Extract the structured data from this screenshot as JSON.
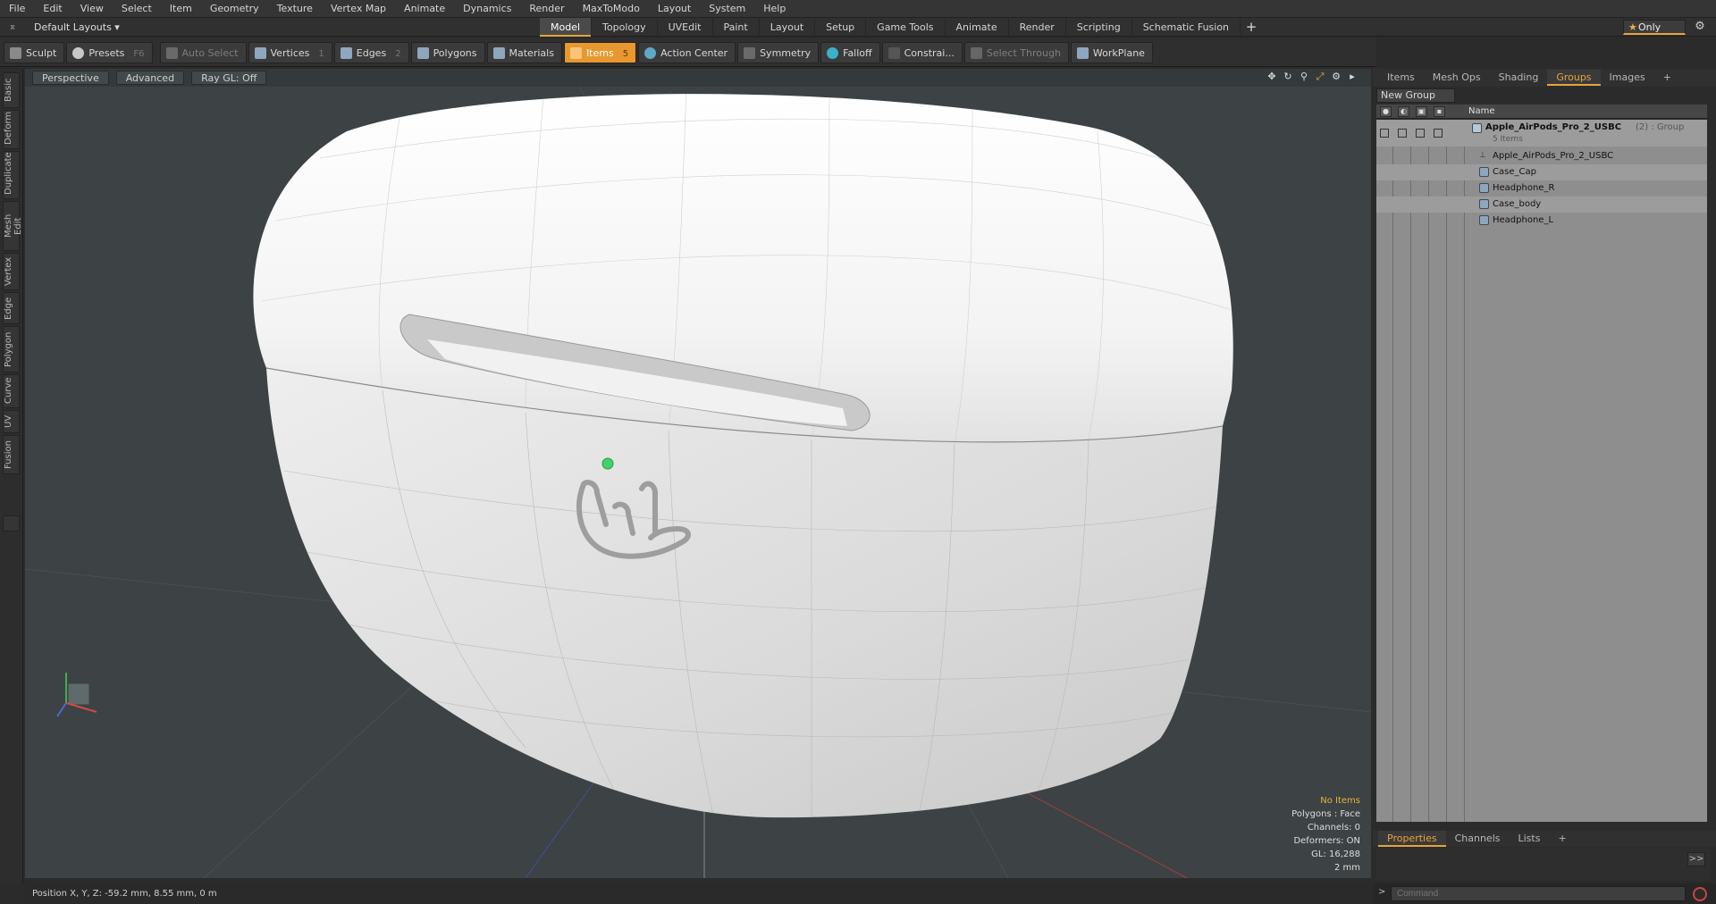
{
  "menubar": {
    "items": [
      "File",
      "Edit",
      "View",
      "Select",
      "Item",
      "Geometry",
      "Texture",
      "Vertex Map",
      "Animate",
      "Dynamics",
      "Render",
      "MaxToModo",
      "Layout",
      "System",
      "Help"
    ]
  },
  "layoutbar": {
    "dropdown": "Default Layouts ▾",
    "tabs": [
      "Model",
      "Topology",
      "UVEdit",
      "Paint",
      "Layout",
      "Setup",
      "Game Tools",
      "Animate",
      "Render",
      "Scripting",
      "Schematic Fusion"
    ],
    "active_tab": "Model",
    "add": "+",
    "only_label": "Only"
  },
  "toolbar": {
    "sculpt": "Sculpt",
    "presets": "Presets",
    "presets_key": "F6",
    "auto_select": "Auto Select",
    "vertices": "Vertices",
    "vertices_num": "1",
    "edges": "Edges",
    "edges_num": "2",
    "polygons": "Polygons",
    "materials": "Materials",
    "items": "Items",
    "items_num": "5",
    "action_center": "Action Center",
    "symmetry": "Symmetry",
    "falloff": "Falloff",
    "constrain": "Constrai...",
    "select_through": "Select Through",
    "workplane": "WorkPlane"
  },
  "left_tabs": [
    "Basic",
    "Deform",
    "Duplicate",
    "Mesh Edit",
    "Vertex",
    "Edge",
    "Polygon",
    "Curve",
    "UV",
    "Fusion"
  ],
  "viewport": {
    "view": "Perspective",
    "shading": "Advanced",
    "raygl": "Ray GL: Off",
    "info": {
      "selection": "No Items",
      "polygons": "Polygons : Face",
      "channels": "Channels: 0",
      "deformers": "Deformers: ON",
      "gl": "GL: 16,288",
      "scale": "2 mm"
    }
  },
  "statusbar": {
    "position": "Position X, Y, Z:   -59.2 mm, 8.55 mm, 0 m"
  },
  "right_panel": {
    "tabs": [
      "Items",
      "Mesh Ops",
      "Shading",
      "Groups",
      "Images"
    ],
    "active_tab": "Groups",
    "add": "+",
    "new_group": "New Group",
    "name_header": "Name",
    "group": {
      "name": "Apple_AirPods_Pro_2_USBC",
      "suffix": "(2) : Group",
      "count": "5 Items"
    },
    "children": [
      "Apple_AirPods_Pro_2_USBC",
      "Case_Cap",
      "Headphone_R",
      "Case_body",
      "Headphone_L"
    ]
  },
  "bottom_panel": {
    "tabs": [
      "Properties",
      "Channels",
      "Lists"
    ],
    "active_tab": "Properties",
    "add": "+",
    "expand": ">>",
    "command_placeholder": "Command"
  },
  "colors": {
    "accent": "#e8982e",
    "viewport_bg": "#3d4244",
    "led": "#3fd36b"
  }
}
